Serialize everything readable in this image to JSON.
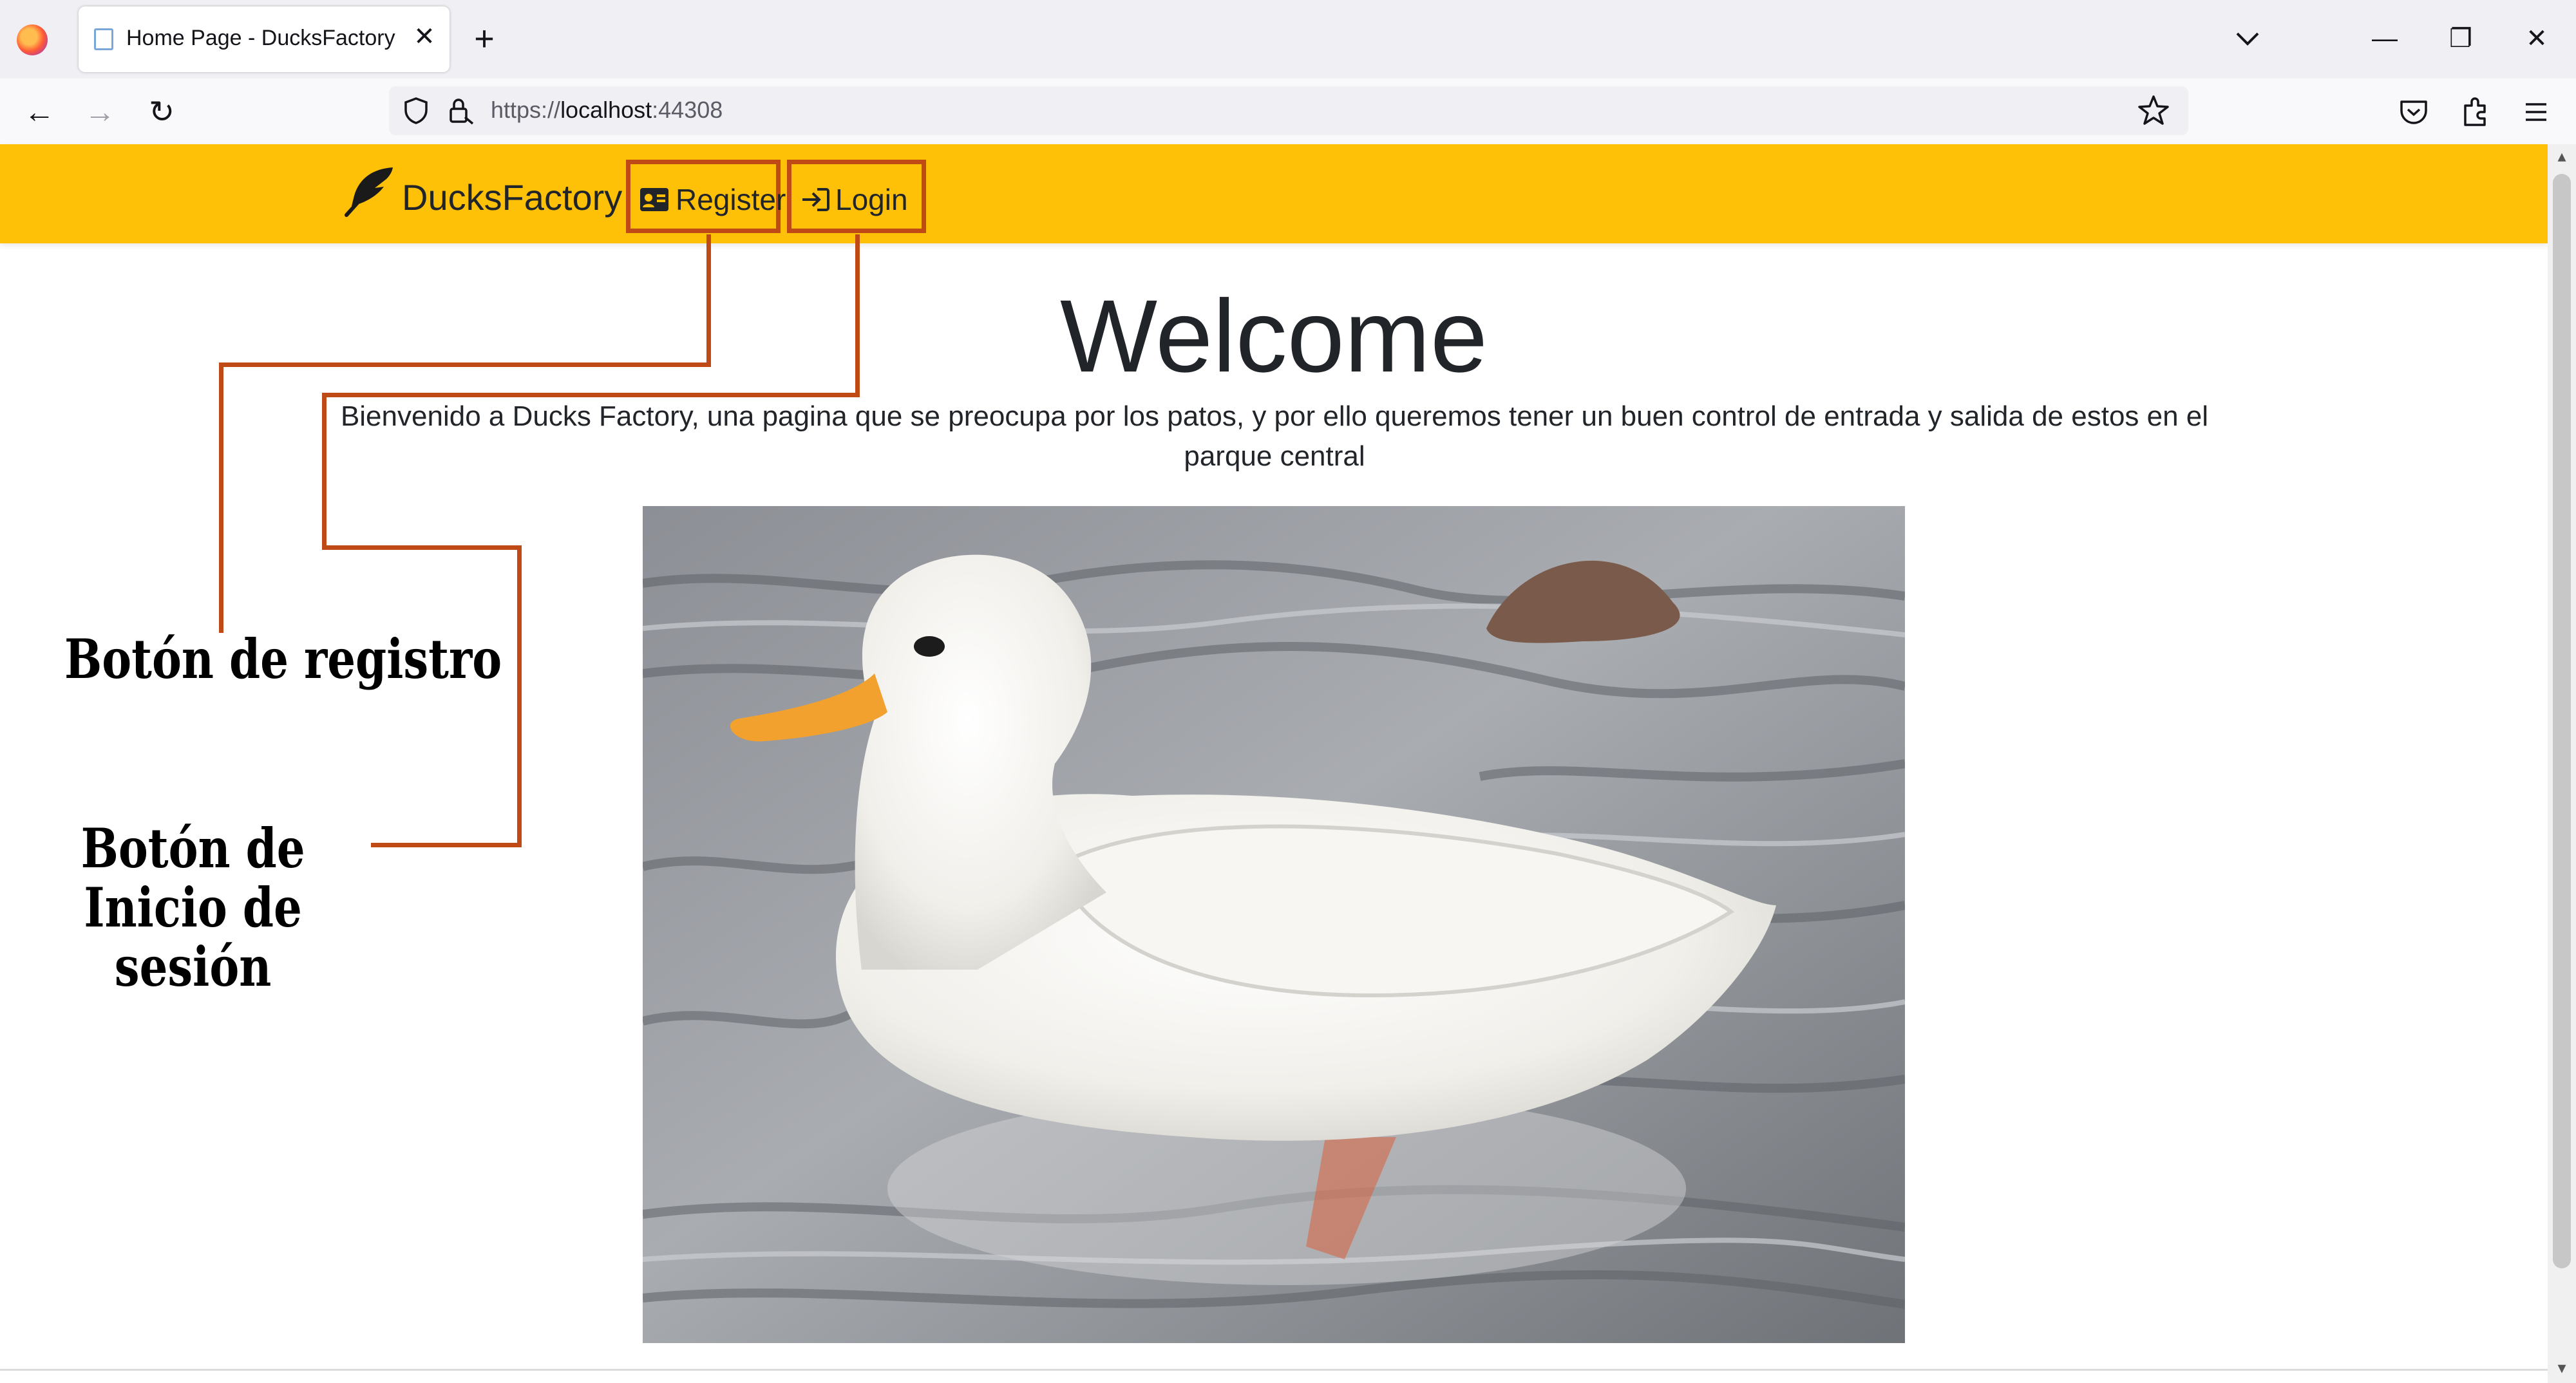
{
  "browser": {
    "tab": {
      "title": "Home Page - DucksFactory"
    },
    "new_tab_symbol": "+",
    "url": {
      "scheme": "https://",
      "host": "localhost",
      "port": ":44308"
    },
    "icons": [
      "firefox-logo",
      "page-favicon",
      "close-icon",
      "chevron-down-icon",
      "minimize-icon",
      "restore-icon",
      "window-close-icon",
      "back-arrow-icon",
      "forward-arrow-icon",
      "reload-icon",
      "shield-icon",
      "lock-icon",
      "star-icon",
      "pocket-icon",
      "extensions-icon",
      "hamburger-menu-icon"
    ]
  },
  "site": {
    "brand": "DucksFactory",
    "nav": {
      "register_label": "Register",
      "login_label": "Login"
    },
    "heading": "Welcome",
    "description": "Bienvenido a Ducks Factory, una pagina que se preocupa por los patos, y por ello queremos tener un buen control de entrada y salida de estos en el parque central",
    "colors": {
      "navbar": "#ffc107",
      "annotation": "#c04a16"
    }
  },
  "annotations": {
    "register": "Botón de registro",
    "login": "Botón de Inicio de sesión"
  }
}
